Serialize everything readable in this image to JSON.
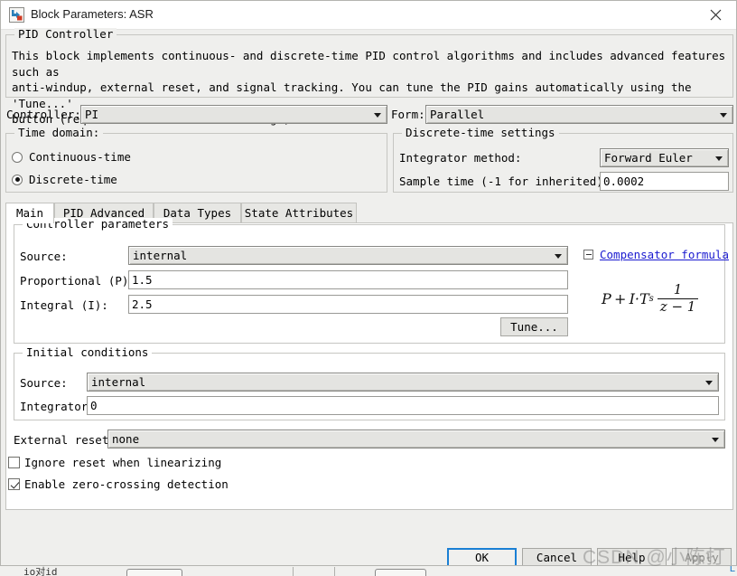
{
  "window": {
    "title": "Block Parameters: ASR",
    "icon": "simulink-block-icon",
    "close_label": "✕"
  },
  "description_group": {
    "title": "PID Controller",
    "text": "This block implements continuous- and discrete-time PID control algorithms and includes advanced features such as\nanti-windup, external reset, and signal tracking. You can tune the PID gains automatically using the 'Tune...'\nbutton (requires Simulink Control Design)."
  },
  "top_row": {
    "controller_label": "Controller:",
    "controller_value": "PI",
    "form_label": "Form:",
    "form_value": "Parallel"
  },
  "time_domain": {
    "title": "Time domain:",
    "options": [
      {
        "label": "Continuous-time",
        "selected": false
      },
      {
        "label": "Discrete-time",
        "selected": true
      }
    ]
  },
  "discrete_settings": {
    "title": "Discrete-time settings",
    "integrator_method_label": "Integrator method:",
    "integrator_method_value": "Forward Euler",
    "sample_time_label": "Sample time (-1 for inherited):",
    "sample_time_value": "0.0002"
  },
  "tabs": [
    {
      "label": "Main",
      "active": true
    },
    {
      "label": "PID Advanced",
      "active": false
    },
    {
      "label": "Data Types",
      "active": false
    },
    {
      "label": "State Attributes",
      "active": false
    }
  ],
  "controller_parameters": {
    "title": "Controller parameters",
    "source_label": "Source:",
    "source_value": "internal",
    "proportional_label": "Proportional (P):",
    "proportional_value": "1.5",
    "integral_label": "Integral (I):",
    "integral_value": "2.5",
    "tune_button": "Tune..."
  },
  "compensator": {
    "link_label": "Compensator formula",
    "formula_plain": "P + I·Ts · 1/(z-1)",
    "formula_parts": {
      "lead": "P + I·T",
      "sub": "s",
      "numerator": "1",
      "denominator": "z − 1"
    }
  },
  "initial_conditions": {
    "title": "Initial conditions",
    "source_label": "Source:",
    "source_value": "internal",
    "integrator_label": "Integrator:",
    "integrator_value": "0"
  },
  "external_reset": {
    "label": "External reset:",
    "value": "none"
  },
  "checkboxes": [
    {
      "label": "Ignore reset when linearizing",
      "checked": false
    },
    {
      "label": "Enable zero-crossing detection",
      "checked": true
    }
  ],
  "footer_buttons": [
    {
      "label": "OK",
      "default": true,
      "disabled": false
    },
    {
      "label": "Cancel",
      "default": false,
      "disabled": false
    },
    {
      "label": "Help",
      "default": false,
      "disabled": false
    },
    {
      "label": "Apply",
      "default": false,
      "disabled": true
    }
  ],
  "watermark": {
    "text": "CSDN @小陈打"
  },
  "background_window": {
    "text": "io对id"
  },
  "colors": {
    "dialog_bg": "#efefed",
    "panel_white": "#ffffff",
    "field_bg": "#e4e4e1",
    "border": "#c6c6c2",
    "accent_focus": "#1a7fd4",
    "link": "#1a1ad0"
  }
}
